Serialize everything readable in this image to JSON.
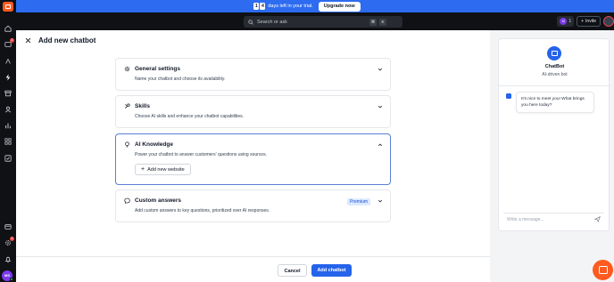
{
  "banner": {
    "digit1": "1",
    "digit2": "4",
    "message": "days left in your trial.",
    "upgrade_label": "Upgrade now"
  },
  "topbar": {
    "search_placeholder": "Search or ask",
    "shortcut_key1": "⌘",
    "shortcut_key2": "K",
    "counter_avatar": "M",
    "counter_value": "1",
    "invite_label": "Invite"
  },
  "rail": {
    "inbox_badge": "2",
    "settings_badge": "2",
    "user_initials": "MS"
  },
  "page": {
    "title": "Add new chatbot"
  },
  "sections": [
    {
      "title": "General settings",
      "description": "Name your chatbot and choose its availability."
    },
    {
      "title": "Skills",
      "description": "Choose AI skills and enhance your chatbot capabilities."
    },
    {
      "title": "AI Knowledge",
      "description": "Power your chatbot to answer customers' questions using sources.",
      "button_label": "Add new website"
    },
    {
      "title": "Custom answers",
      "description": "Add custom answers to key questions, prioritized over AI responses.",
      "badge": "Premium"
    }
  ],
  "footer": {
    "cancel_label": "Cancel",
    "add_label": "Add chatbot"
  },
  "preview": {
    "bot_name": "ChatBot",
    "bot_subtitle": "AI-driven bot",
    "greeting": "It's nice to meet you! What brings you here today?",
    "input_placeholder": "Write a message..."
  },
  "colors": {
    "brand_orange": "#ff5a1f",
    "banner_blue": "#2d6bf0",
    "primary_button": "#2563eb",
    "premium_badge_bg": "#dbeafe"
  }
}
